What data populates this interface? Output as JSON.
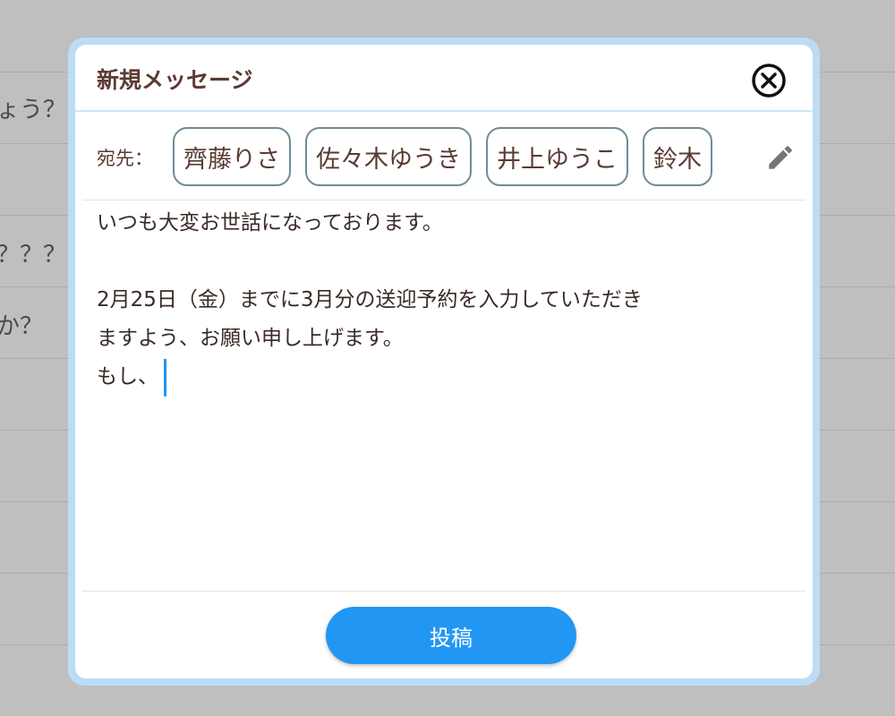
{
  "background": {
    "snippets": [
      "ょう？",
      "？？？",
      "か？"
    ]
  },
  "dialog": {
    "title": "新規メッセージ",
    "close_icon": "close-circle-icon",
    "to_label": "宛先：",
    "recipients": [
      "齊藤りさ",
      "佐々木ゆうき",
      "井上ゆうこ",
      "鈴木"
    ],
    "edit_icon": "pencil-icon",
    "message_lines": [
      "いつも大変お世話になっております。",
      "",
      "2月25日（金）までに3月分の送迎予約を入力していただき",
      "ますよう、お願い申し上げます。",
      "もし、"
    ],
    "post_button_label": "投稿"
  },
  "colors": {
    "accent": "#2196f3",
    "title_text": "#5a3a32",
    "chip_border": "#6f8c96",
    "modal_frame": "#bcdcf5",
    "overlay": "#bfbfbf"
  }
}
